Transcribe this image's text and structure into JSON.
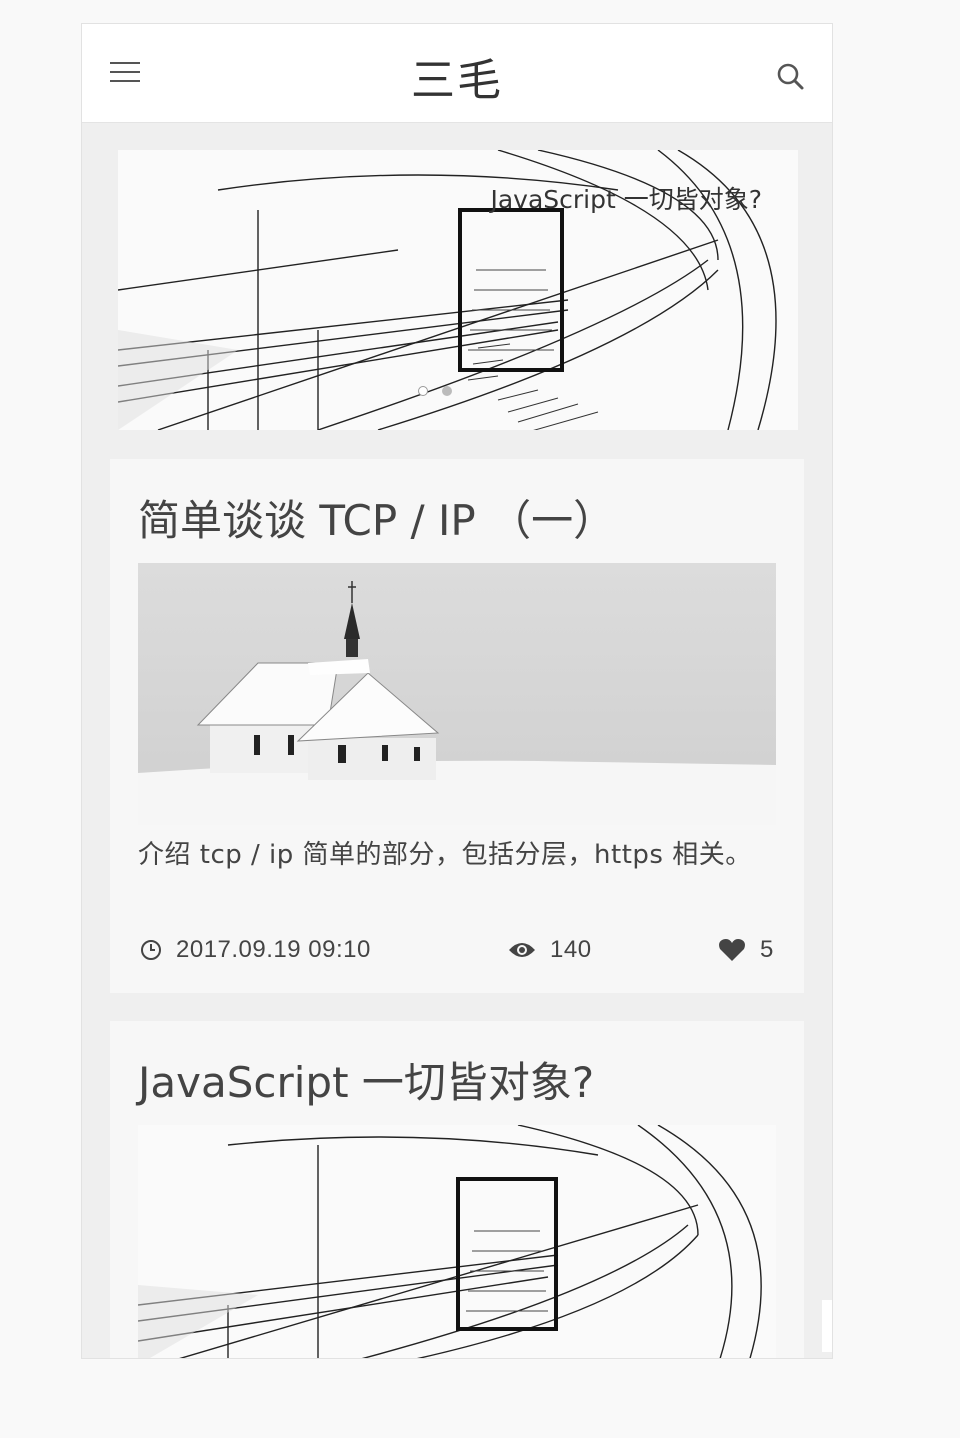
{
  "header": {
    "title": "三毛",
    "menu_icon": "hamburger-icon",
    "search_icon": "search-icon"
  },
  "banner": {
    "title": "JavaScript 一切皆对象?",
    "image": "tunnel-sketch-image",
    "dots": 2,
    "active_dot": 1
  },
  "posts": [
    {
      "title": "简单谈谈 TCP / IP （一）",
      "image": "snowy-chapel-image",
      "excerpt": "介绍 tcp / ip 简单的部分，包括分层，https 相关。",
      "date": "2017.09.19 09:10",
      "views": "140",
      "likes": "5"
    },
    {
      "title": "JavaScript 一切皆对象?",
      "image": "tunnel-sketch-image"
    }
  ],
  "floating": {
    "mail_icon": "mail-icon",
    "mail_color": "#d9534f"
  }
}
